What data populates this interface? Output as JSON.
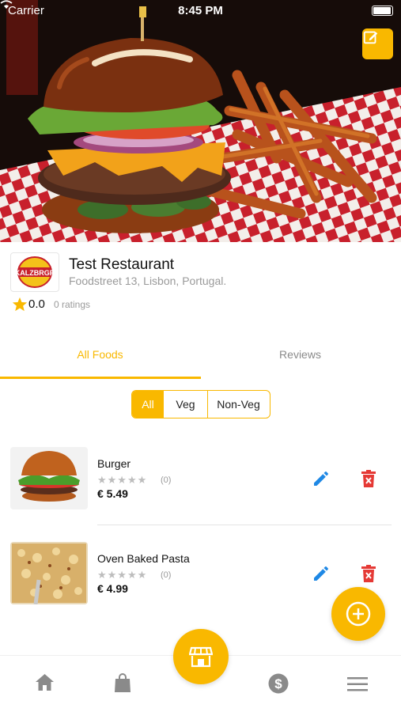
{
  "status_bar": {
    "carrier": "Carrier",
    "time": "8:45 PM"
  },
  "restaurant": {
    "logo_text": "KALZBRGR",
    "name": "Test Restaurant",
    "address": "Foodstreet 13, Lisbon, Portugal.",
    "rating": "0.0",
    "rating_count": "0 ratings"
  },
  "tabs": [
    {
      "label": "All Foods",
      "active": true
    },
    {
      "label": "Reviews",
      "active": false
    }
  ],
  "filter": {
    "options": [
      "All",
      "Veg",
      "Non-Veg"
    ],
    "selected": "All"
  },
  "foods": [
    {
      "name": "Burger",
      "stars": "★★★★★",
      "rating_count": "(0)",
      "price": "€ 5.49"
    },
    {
      "name": "Oven Baked Pasta",
      "stars": "★★★★★",
      "rating_count": "(0)",
      "price": "€ 4.99"
    }
  ],
  "colors": {
    "accent": "#f9b800",
    "edit_icon": "#1e88e5",
    "delete_icon": "#e53935"
  },
  "icons": {
    "hero_edit": "edit-square-icon",
    "food_edit": "pencil-icon",
    "food_delete": "trash-icon",
    "fab": "plus-circle-icon",
    "nav": [
      "home-icon",
      "shopping-bag-icon",
      "store-icon",
      "dollar-icon",
      "menu-icon"
    ]
  }
}
